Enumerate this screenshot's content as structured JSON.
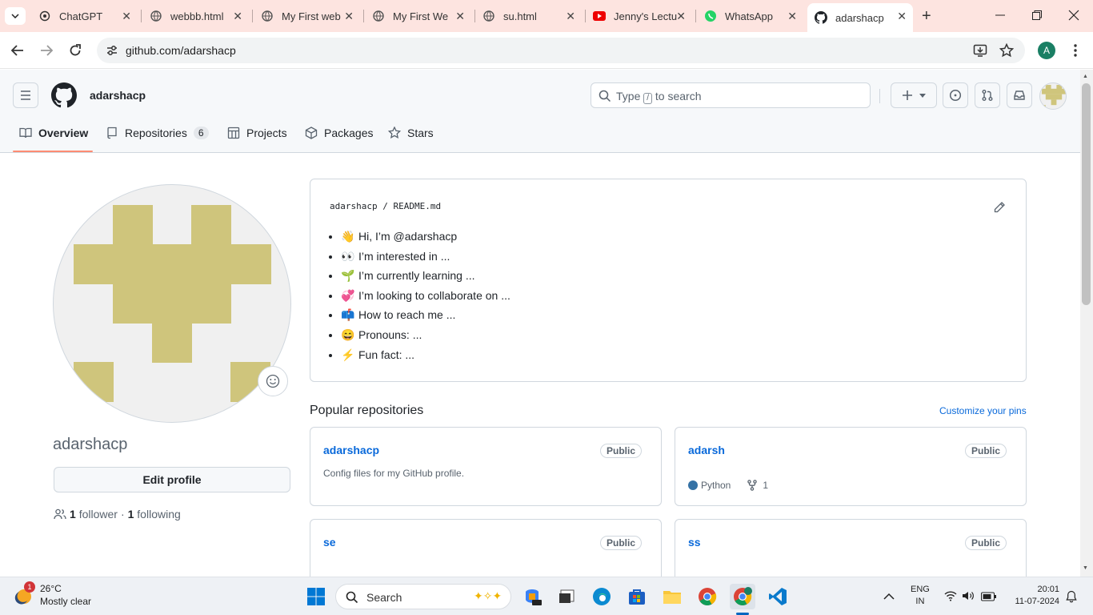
{
  "browser": {
    "tabs": [
      {
        "title": "ChatGPT"
      },
      {
        "title": "webbb.html"
      },
      {
        "title": "My First web"
      },
      {
        "title": "My First We"
      },
      {
        "title": "su.html"
      },
      {
        "title": "Jenny's Lectu"
      },
      {
        "title": "WhatsApp"
      },
      {
        "title": "adarshacp"
      }
    ],
    "url": "github.com/adarshacp",
    "profile_initial": "A"
  },
  "github": {
    "username": "adarshacp",
    "search_prefix": "Type",
    "search_key": "/",
    "search_suffix": "to search",
    "nav": {
      "overview": "Overview",
      "repositories": "Repositories",
      "repositories_count": "6",
      "projects": "Projects",
      "packages": "Packages",
      "stars": "Stars"
    },
    "profile": {
      "display_username": "adarshacp",
      "edit_button": "Edit profile",
      "followers_count": "1",
      "followers_label": "follower",
      "separator": "·",
      "following_count": "1",
      "following_label": "following"
    },
    "readme": {
      "owner": "adarshacp",
      "slash": "/",
      "file": "README.md",
      "items": [
        {
          "emoji": "👋",
          "text": "Hi, I’m @adarshacp"
        },
        {
          "emoji": "👀",
          "text": "I’m interested in ..."
        },
        {
          "emoji": "🌱",
          "text": "I’m currently learning ..."
        },
        {
          "emoji": "💞️",
          "text": "I’m looking to collaborate on ..."
        },
        {
          "emoji": "📫",
          "text": "How to reach me ..."
        },
        {
          "emoji": "😄",
          "text": "Pronouns: ..."
        },
        {
          "emoji": "⚡",
          "text": "Fun fact: ..."
        }
      ]
    },
    "popular": {
      "title": "Popular repositories",
      "customize": "Customize your pins",
      "repos": [
        {
          "name": "adarshacp",
          "visibility": "Public",
          "description": "Config files for my GitHub profile."
        },
        {
          "name": "adarsh",
          "visibility": "Public",
          "language": "Python",
          "language_color": "#3572A5",
          "forks": "1"
        },
        {
          "name": "se",
          "visibility": "Public"
        },
        {
          "name": "ss",
          "visibility": "Public"
        }
      ]
    }
  },
  "taskbar": {
    "weather_badge": "1",
    "temperature": "26°C",
    "condition": "Mostly clear",
    "search": "Search",
    "language_top": "ENG",
    "language_bottom": "IN",
    "time": "20:01",
    "date": "11-07-2024"
  }
}
